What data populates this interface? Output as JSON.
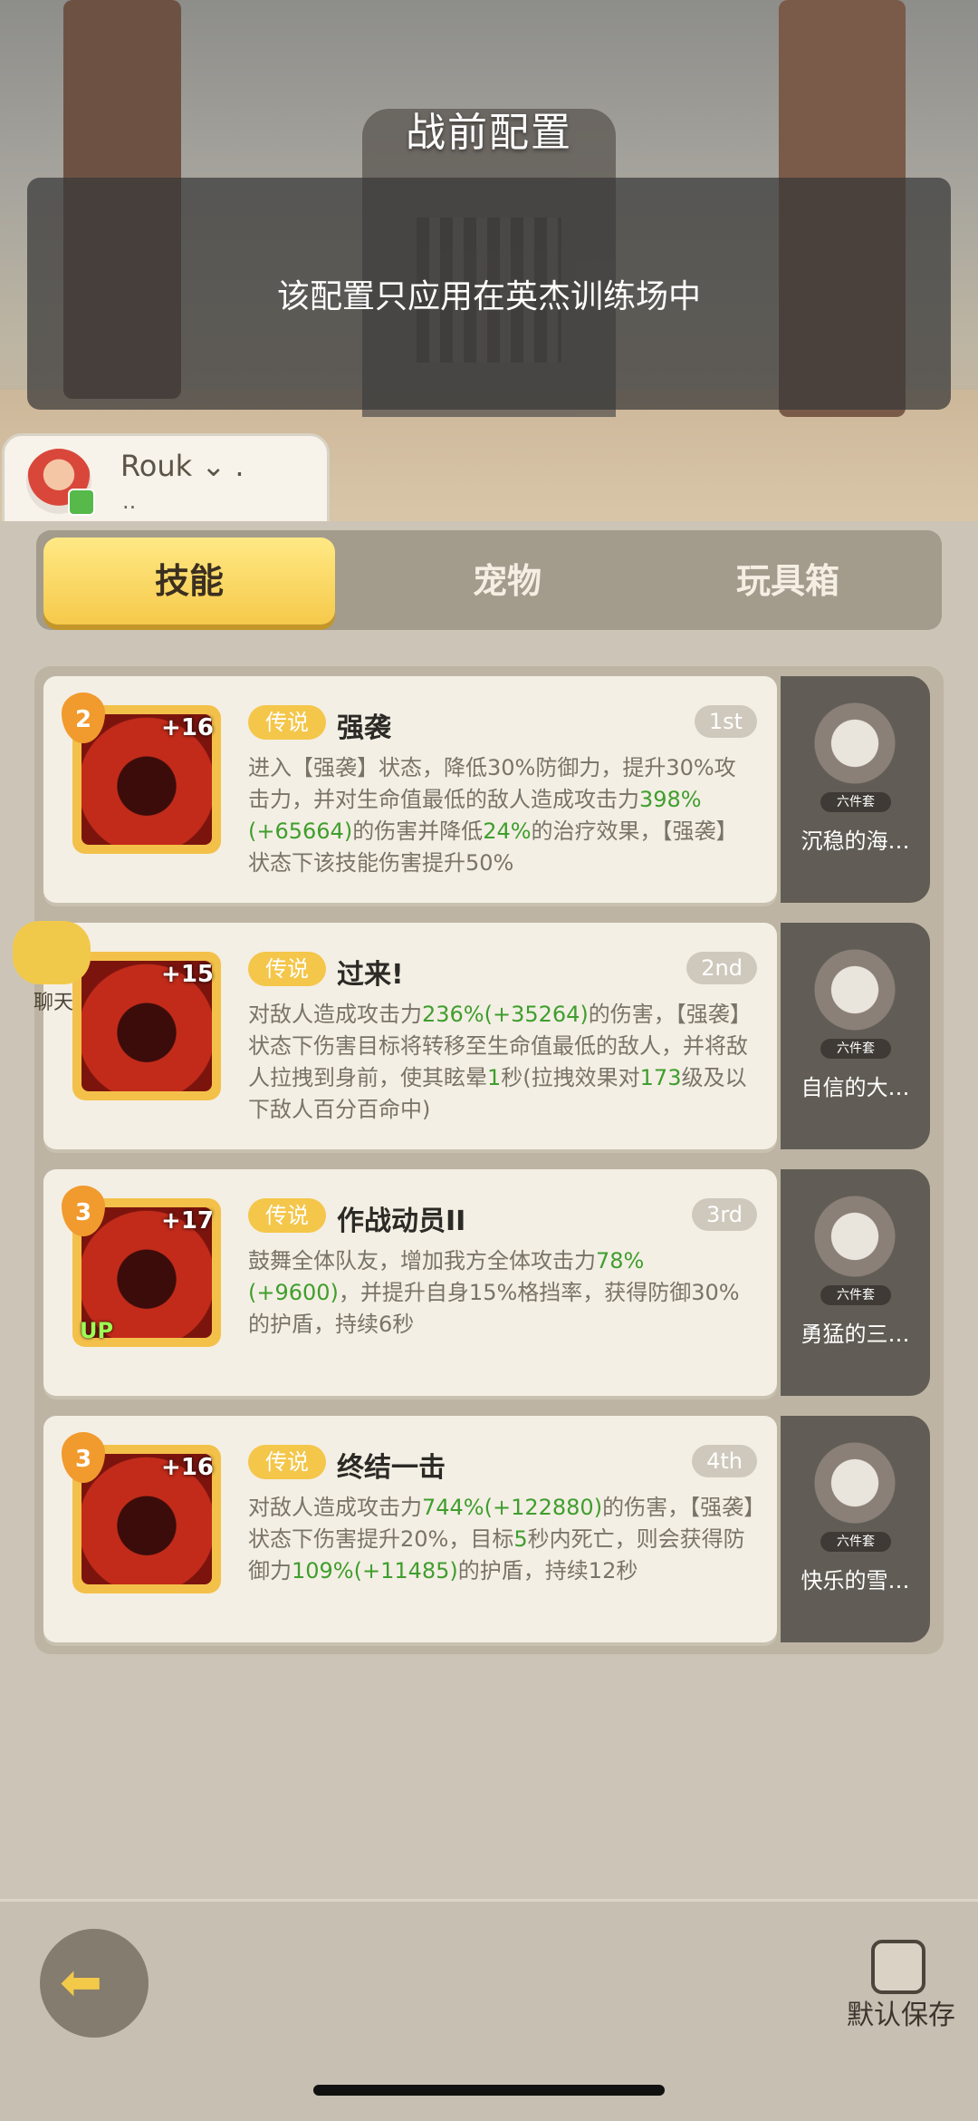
{
  "header": {
    "title": "战前配置",
    "notice": "该配置只应用在英杰训练场中"
  },
  "profile": {
    "name": "Rouk ⌄ .",
    "sub": ".."
  },
  "tabs": [
    {
      "label": "技能"
    },
    {
      "label": "宠物"
    },
    {
      "label": "玩具箱"
    }
  ],
  "chat": {
    "label": "聊天"
  },
  "skills": [
    {
      "level": "2",
      "plus": "+16",
      "rarity": "传说",
      "name": "强袭",
      "rank": "1st",
      "pet_tag": "六件套",
      "pet_name": "沉稳的海…",
      "desc": [
        "进入【强袭】状态，降低30%防御力，提升30%攻击力，并对生命值最低的敌人造成攻击力",
        "398%(+65664)",
        "的伤害并降低",
        "24%",
        "的治疗效果，【强袭】状态下该技能伤害提升50%"
      ]
    },
    {
      "level": "",
      "plus": "+15",
      "rarity": "传说",
      "name": "过来!",
      "rank": "2nd",
      "pet_tag": "六件套",
      "pet_name": "自信的大…",
      "desc": [
        "对敌人造成攻击力",
        "236%(+35264)",
        "的伤害，【强袭】状态下伤害目标将转移至生命值最低的敌人，并将敌人拉拽到身前，使其眩晕",
        "1",
        "秒(拉拽效果对",
        "173",
        "级及以下敌人百分百命中)"
      ]
    },
    {
      "level": "3",
      "plus": "+17",
      "rarity": "传说",
      "name": "作战动员II",
      "rank": "3rd",
      "up": "UP",
      "pet_tag": "六件套",
      "pet_name": "勇猛的三…",
      "desc": [
        "鼓舞全体队友，增加我方全体攻击力",
        "78%(+9600)",
        "，并提升自身15%格挡率，获得防御30%的护盾，持续6秒"
      ]
    },
    {
      "level": "3",
      "plus": "+16",
      "rarity": "传说",
      "name": "终结一击",
      "rank": "4th",
      "pet_tag": "六件套",
      "pet_name": "快乐的雪…",
      "desc": [
        "对敌人造成攻击力",
        "744%(+122880)",
        "的伤害，【强袭】状态下伤害提升20%，目标",
        "5",
        "秒内死亡，则会获得防御力",
        "109%(+11485)",
        "的护盾，持续12秒"
      ]
    }
  ],
  "footer": {
    "save_label": "默认保存",
    "back_icon": "back-arrow-icon"
  },
  "colors": {
    "accent": "#f6c94a",
    "highlight": "#3f9e2e",
    "rarity": "#f4c64a"
  }
}
